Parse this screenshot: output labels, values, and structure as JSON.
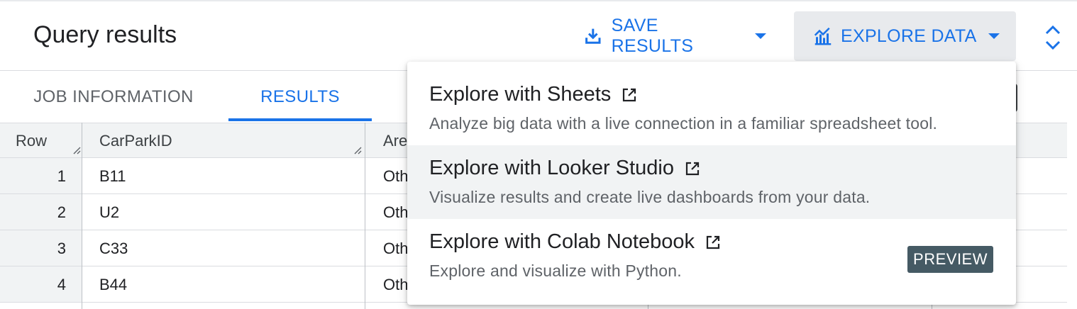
{
  "header": {
    "title": "Query results",
    "save_label": "SAVE RESULTS",
    "explore_label": "EXPLORE DATA"
  },
  "tabs": [
    {
      "label": "JOB INFORMATION",
      "active": false
    },
    {
      "label": "RESULTS",
      "active": true
    }
  ],
  "table": {
    "columns": [
      "Row",
      "CarParkID",
      "Are"
    ],
    "rows": [
      {
        "row": "1",
        "carpark_id": "B11",
        "area": "Oth"
      },
      {
        "row": "2",
        "carpark_id": "U2",
        "area": "Oth"
      },
      {
        "row": "3",
        "carpark_id": "C33",
        "area": "Oth"
      },
      {
        "row": "4",
        "carpark_id": "B44",
        "area": "Oth"
      }
    ]
  },
  "menu": {
    "items": [
      {
        "title": "Explore with Sheets",
        "description": "Analyze big data with a live connection in a familiar spreadsheet tool.",
        "badge": ""
      },
      {
        "title": "Explore with Looker Studio",
        "description": "Visualize results and create live dashboards from your data.",
        "badge": ""
      },
      {
        "title": "Explore with Colab Notebook",
        "description": "Explore and visualize with Python.",
        "badge": "PREVIEW"
      }
    ]
  },
  "icons": {
    "save": "download-icon",
    "explore": "chart-icon",
    "expand": "unfold-icon",
    "external": "open-in-new-icon"
  },
  "colors": {
    "accent": "#1a73e8",
    "badge_bg": "#455a64",
    "header_bg": "#f1f3f4"
  }
}
